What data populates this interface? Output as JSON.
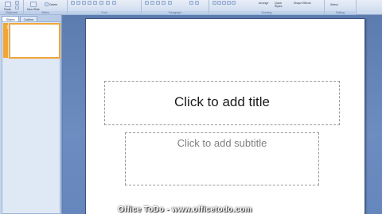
{
  "ribbon": {
    "groups": [
      {
        "label": "Clipboard",
        "buttons": [
          "Paste"
        ]
      },
      {
        "label": "Slides",
        "buttons": [
          "New Slide",
          "Delete"
        ]
      },
      {
        "label": "Font",
        "buttons": []
      },
      {
        "label": "Paragraph",
        "buttons": []
      },
      {
        "label": "Drawing",
        "buttons": [
          "Arrange",
          "Quick Styles",
          "Shape Effects"
        ]
      },
      {
        "label": "Editing",
        "buttons": [
          "Select"
        ]
      }
    ]
  },
  "panel": {
    "tabs": [
      "Slides",
      "Outline"
    ],
    "active_tab": "Slides",
    "slide_number": "1"
  },
  "slide": {
    "title_placeholder": "Click to add title",
    "subtitle_placeholder": "Click to add subtitle"
  },
  "watermark": "Office ToDo  -  www.officetodo.com",
  "colors": {
    "ribbon": "#d6e1f1",
    "workspace": "#5f7fb4",
    "selection": "#f4a633",
    "slide": "#ffffff"
  }
}
